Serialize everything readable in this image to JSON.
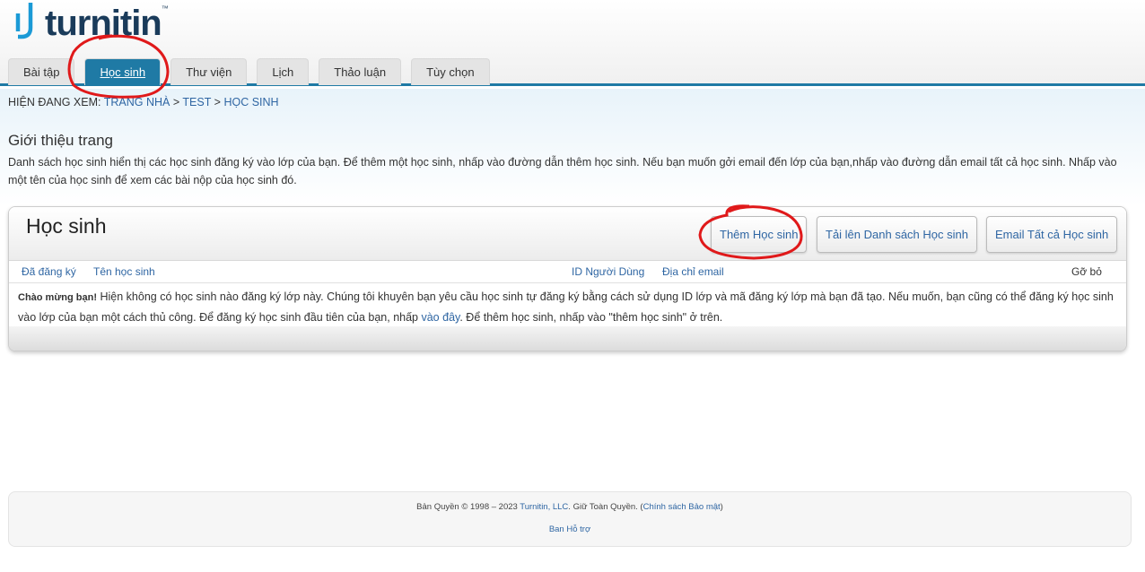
{
  "brand": {
    "name": "turnitin",
    "tm": "™"
  },
  "tabs": [
    {
      "label": "Bài tập",
      "active": false
    },
    {
      "label": "Học sinh",
      "active": true
    },
    {
      "label": "Thư viện",
      "active": false
    },
    {
      "label": "Lịch",
      "active": false
    },
    {
      "label": "Thảo luận",
      "active": false
    },
    {
      "label": "Tùy chọn",
      "active": false
    }
  ],
  "breadcrumb": {
    "prefix": "Hiện đang xem:",
    "home": "Trang nhà",
    "sep": ">",
    "class": "Test",
    "current": "Học sinh"
  },
  "intro": {
    "title": "Giới thiệu trang",
    "text": "Danh sách học sinh hiển thị các học sinh đăng ký vào lớp của bạn. Để thêm một học sinh, nhấp vào đường dẫn thêm học sinh. Nếu bạn muốn gởi email đến lớp của bạn,nhấp vào đường dẫn email tất cả học sinh. Nhấp vào một tên của học sinh để xem các bài nộp của học sinh đó."
  },
  "panel": {
    "title": "Học sinh",
    "buttons": {
      "add": "Thêm Học sinh",
      "upload": "Tải lên Danh sách Học sinh",
      "email": "Email Tất cả Học sinh"
    },
    "columns": {
      "enrolled": "Đã đăng ký",
      "name": "Tên học sinh",
      "user_id": "ID Người Dùng",
      "email": "Địa chỉ email",
      "remove": "Gỡ bỏ"
    },
    "message": {
      "welcome": "Chào mừng bạn!",
      "body": " Hiện không có học sinh nào đăng ký lớp này. Chúng tôi khuyên bạn yêu cầu học sinh tự đăng ký bằng cách sử dụng ID lớp và mã đăng ký lớp mà bạn đã tạo. Nếu muốn, bạn cũng có thể đăng ký học sinh vào lớp của bạn một cách thủ công. Để đăng ký học sinh đầu tiên của bạn, nhấp ",
      "link": "vào đây",
      "tail": ". Để thêm học sinh, nhấp vào \"thêm học sinh\" ở trên."
    }
  },
  "footer": {
    "copyright": "Bản Quyền © 1998 – 2023 ",
    "company": "Turnitin, LLC",
    "rights": ". Giữ Toàn Quyền. (",
    "privacy": "Chính sách Bảo mật",
    "close": ")",
    "support": "Ban Hỗ trợ"
  },
  "colors": {
    "accent": "#1f7aa5",
    "link": "#2f66a3",
    "annotation": "#e0191a"
  }
}
